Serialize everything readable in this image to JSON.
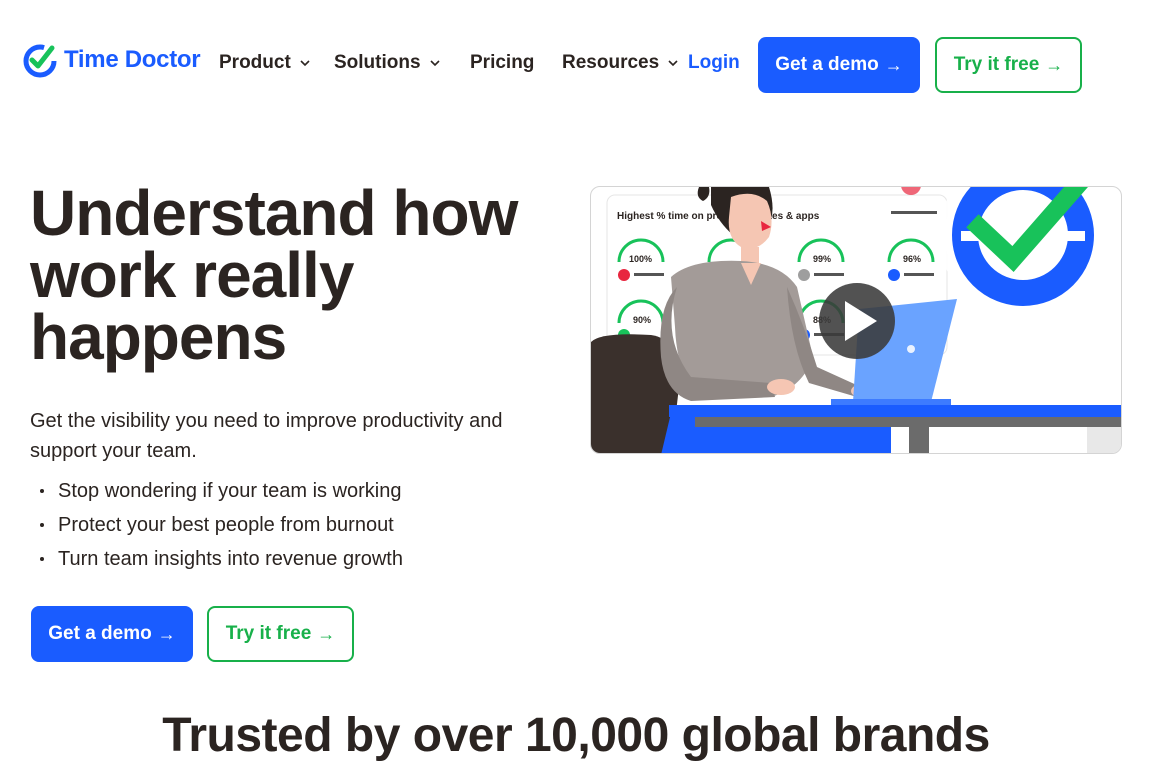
{
  "nav": {
    "logo_text": "Time Doctor",
    "items": [
      {
        "label": "Product",
        "dropdown": true
      },
      {
        "label": "Solutions",
        "dropdown": true
      },
      {
        "label": "Pricing",
        "dropdown": false
      },
      {
        "label": "Resources",
        "dropdown": true
      }
    ],
    "login": "Login",
    "demo_button": "Get a demo",
    "try_button": "Try it free"
  },
  "hero": {
    "title_lines": [
      "Understand how",
      "work really",
      "happens"
    ],
    "subtitle": "Get the visibility you need to improve productivity and support your team.",
    "bullets": [
      "Stop wondering if your team is working",
      "Protect your best people from burnout",
      "Turn team insights into revenue growth"
    ],
    "demo_button": "Get a demo",
    "try_button": "Try it free",
    "arrow": "→"
  },
  "video": {
    "card_title": "Highest % time on productive sites & apps",
    "stats": [
      {
        "value": "100%",
        "color": "#e8263f"
      },
      {
        "value": "99%",
        "color": "#9e9e9e"
      },
      {
        "value": "96%",
        "color": "#1a5cff"
      },
      {
        "value": "90%",
        "color": "#18c25a"
      },
      {
        "value": "88%",
        "color": "#1a5cff"
      }
    ]
  },
  "trusted": {
    "heading": "Trusted by over 10,000 global brands"
  },
  "colors": {
    "brand_blue": "#1a5cff",
    "brand_green": "#18b04a",
    "text_dark": "#2b2421"
  },
  "icons": [
    "time-doctor-logo-icon",
    "chevron-down-icon",
    "arrow-right-icon",
    "play-icon",
    "checkmark-badge-icon"
  ]
}
